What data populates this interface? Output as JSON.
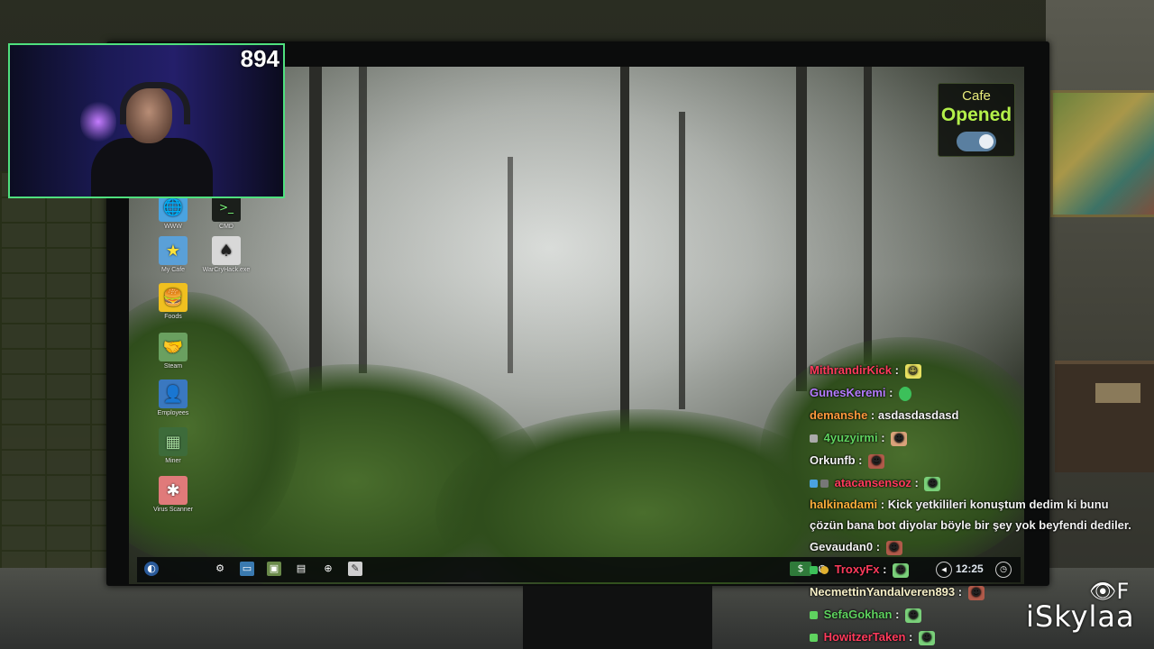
{
  "stream": {
    "viewer_count": "894",
    "watermark": "iSkylaa",
    "watermark_glyph": "F"
  },
  "cafe_widget": {
    "label": "Cafe",
    "status": "Opened",
    "toggle_on": true
  },
  "desktop_icons": [
    {
      "label": "WWW",
      "icon": "globe-icon",
      "color": "#4aa3e0"
    },
    {
      "label": "CMD",
      "icon": "terminal-icon",
      "color": "#1b1f1b"
    },
    {
      "label": "My Cafe",
      "icon": "star-icon",
      "color": "#5aa0d8"
    },
    {
      "label": "WarCryHack.exe",
      "icon": "spade-icon",
      "color": "#d8d8d8"
    },
    {
      "label": "Foods",
      "icon": "food-icon",
      "color": "#f0c020"
    },
    {
      "label": "Steam",
      "icon": "handshake-icon",
      "color": "#6aa060"
    },
    {
      "label": "Employees",
      "icon": "person-icon",
      "color": "#3a78c0"
    },
    {
      "label": "Miner",
      "icon": "chip-icon",
      "color": "#3d6b3a"
    },
    {
      "label": "Virus Scanner",
      "icon": "bug-icon",
      "color": "#e07a7a"
    }
  ],
  "taskbar": {
    "clock": "12:25",
    "items": [
      "start-icon",
      "gear-icon",
      "monitor-icon",
      "image-icon",
      "document-icon",
      "globe-icon",
      "notes-icon"
    ]
  },
  "chat": [
    {
      "user": "MithrandirKick",
      "color": "#ff3b5c",
      "message": "",
      "emote": "face"
    },
    {
      "user": "GunesKeremi",
      "color": "#b57cff",
      "message": "",
      "emote": "blob"
    },
    {
      "user": "demanshe",
      "color": "#ff9a3c",
      "message": "asdasdasdasd",
      "emote": ""
    },
    {
      "user": "4yuzyirmi",
      "color": "#5fd35f",
      "message": "",
      "emote": "face"
    },
    {
      "user": "Orkunfb",
      "color": "#f2f2f2",
      "message": "",
      "emote": "face"
    },
    {
      "user": "atacansensoz",
      "color": "#ff3b5c",
      "message": "",
      "emote": "frog"
    },
    {
      "user": "halkinadami",
      "color": "#ffb03b",
      "message": "Kick yetkilileri konuştum dedim ki bunu çözün bana bot diyolar böyle bir şey yok beyfendi dediler.",
      "emote": ""
    },
    {
      "user": "Gevaudan0",
      "color": "#f2f2f2",
      "message": "",
      "emote": "face"
    },
    {
      "user": "TroxyFx",
      "color": "#ff3b5c",
      "message": "",
      "emote": "frog"
    },
    {
      "user": "NecmettinYandalveren893",
      "color": "#f7f0c8",
      "message": "",
      "emote": "face"
    },
    {
      "user": "SefaGokhan",
      "color": "#5fd35f",
      "message": "",
      "emote": "frog"
    },
    {
      "user": "HowitzerTaken",
      "color": "#ff3b5c",
      "message": "",
      "emote": "frog"
    }
  ]
}
